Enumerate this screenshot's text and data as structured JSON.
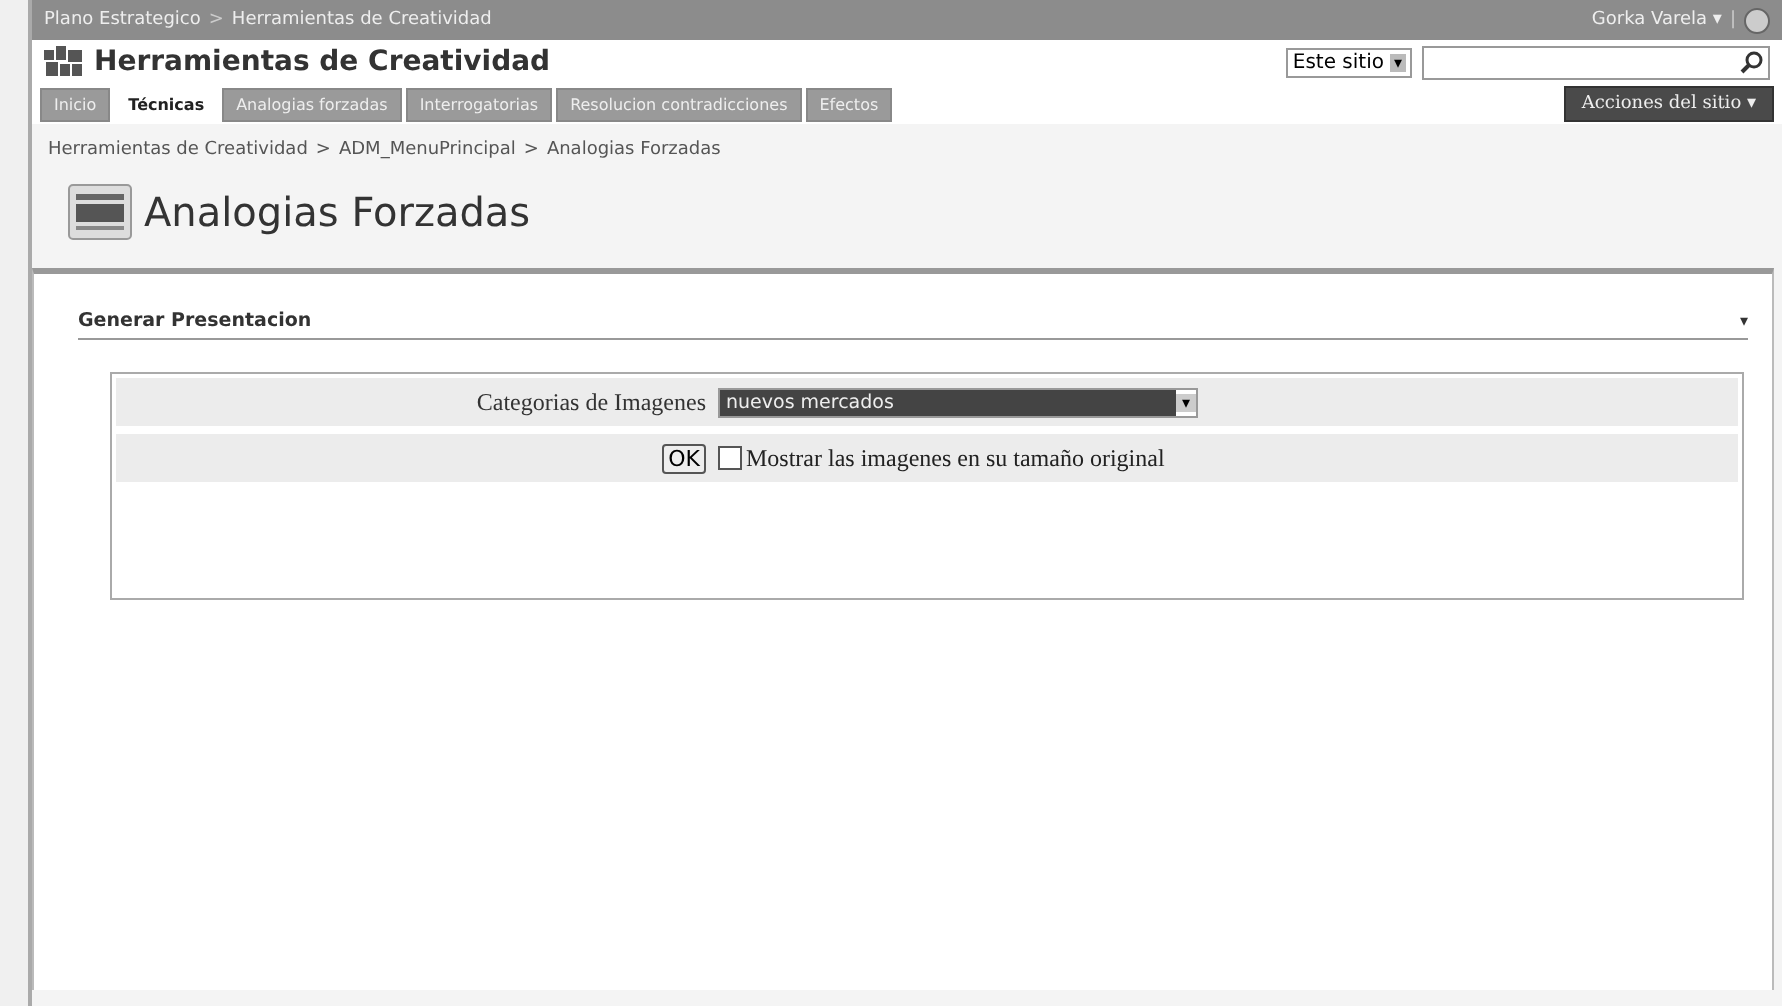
{
  "top_bar": {
    "breadcrumb": [
      "Plano Estrategico",
      "Herramientas de Creatividad"
    ],
    "separator": ">",
    "user": "Gorka Varela",
    "user_caret": "▾",
    "divider": "|"
  },
  "site": {
    "title": "Herramientas de Creatividad"
  },
  "search": {
    "scope": "Este sitio",
    "scope_caret": "▾"
  },
  "tabs": [
    {
      "label": "Inicio",
      "selected": false
    },
    {
      "label": "Técnicas",
      "selected": true
    },
    {
      "label": "Analogias forzadas",
      "selected": false
    },
    {
      "label": "Interrogatorias",
      "selected": false
    },
    {
      "label": "Resolucion contradicciones",
      "selected": false
    },
    {
      "label": "Efectos",
      "selected": false
    }
  ],
  "site_actions": {
    "label": "Acciones del sitio",
    "caret": "▾"
  },
  "breadcrumb": [
    "Herramientas de Creatividad",
    "ADM_MenuPrincipal",
    "Analogias Forzadas"
  ],
  "breadcrumb_separator": ">",
  "page_title": "Analogias Forzadas",
  "webpart": {
    "title": "Generar Presentacion",
    "menu": "▾"
  },
  "form": {
    "category_label": "Categorias de Imagenes",
    "category_value": "nuevos mercados",
    "ok": "OK",
    "option_label": "Mostrar las imagenes en su tamaño original",
    "option_checked": false
  }
}
